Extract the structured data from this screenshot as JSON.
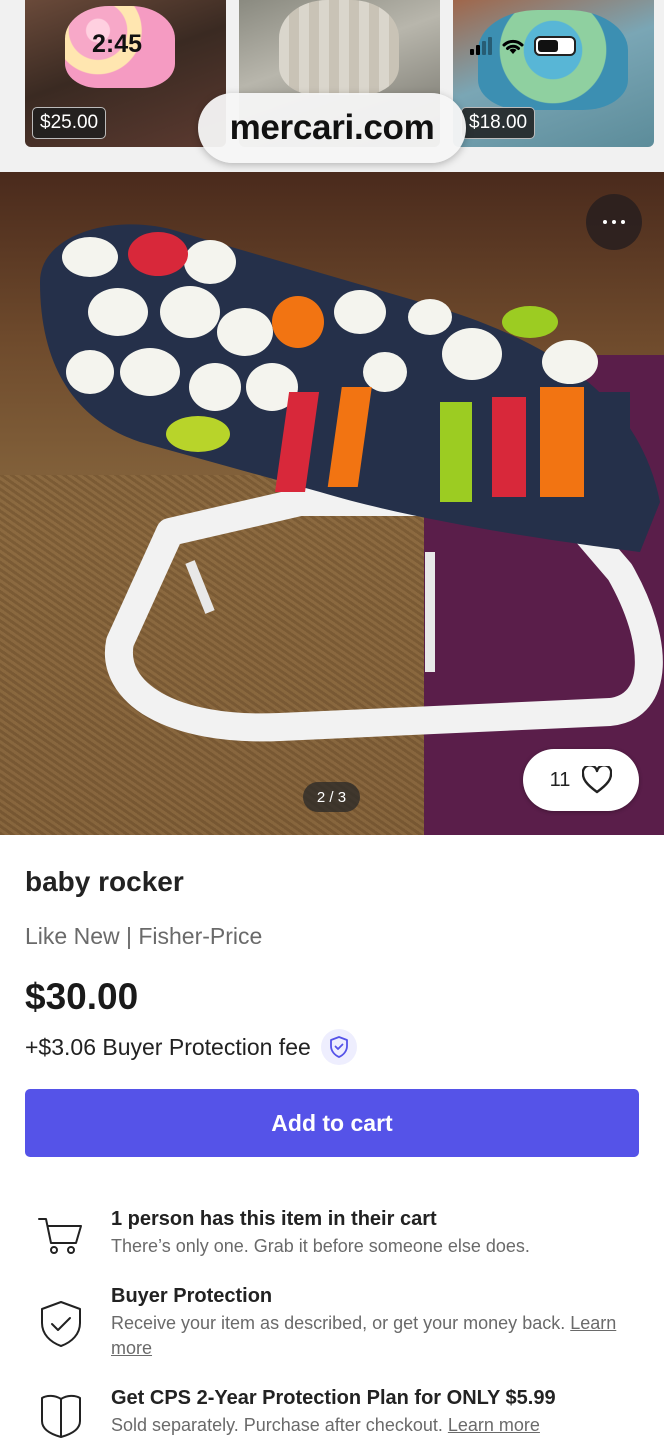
{
  "status_bar": {
    "time": "2:45"
  },
  "browser": {
    "url": "mercari.com"
  },
  "related_items": [
    {
      "price": "$25.00"
    },
    {
      "price": ""
    },
    {
      "price": "$18.00"
    }
  ],
  "gallery": {
    "indicator": "2 / 3",
    "likes": "11"
  },
  "item": {
    "title": "baby rocker",
    "condition_brand": "Like New | Fisher-Price",
    "price": "$30.00",
    "buyer_fee": "+$3.06 Buyer Protection fee"
  },
  "actions": {
    "add_to_cart": "Add to cart"
  },
  "info": [
    {
      "icon": "cart-icon",
      "title": "1 person has this item in their cart",
      "body": "There’s only one. Grab it before someone else does.",
      "link": ""
    },
    {
      "icon": "shield-check-icon",
      "title": "Buyer Protection",
      "body": "Receive your item as described, or get your money back.",
      "link": "Learn more"
    },
    {
      "icon": "protection-plan-icon",
      "title": "Get CPS 2-Year Protection Plan for ONLY $5.99",
      "body": "Sold separately. Purchase after checkout.",
      "link": "Learn more"
    }
  ],
  "colors": {
    "accent": "#5553e8",
    "text_secondary": "#6a6a6a"
  }
}
